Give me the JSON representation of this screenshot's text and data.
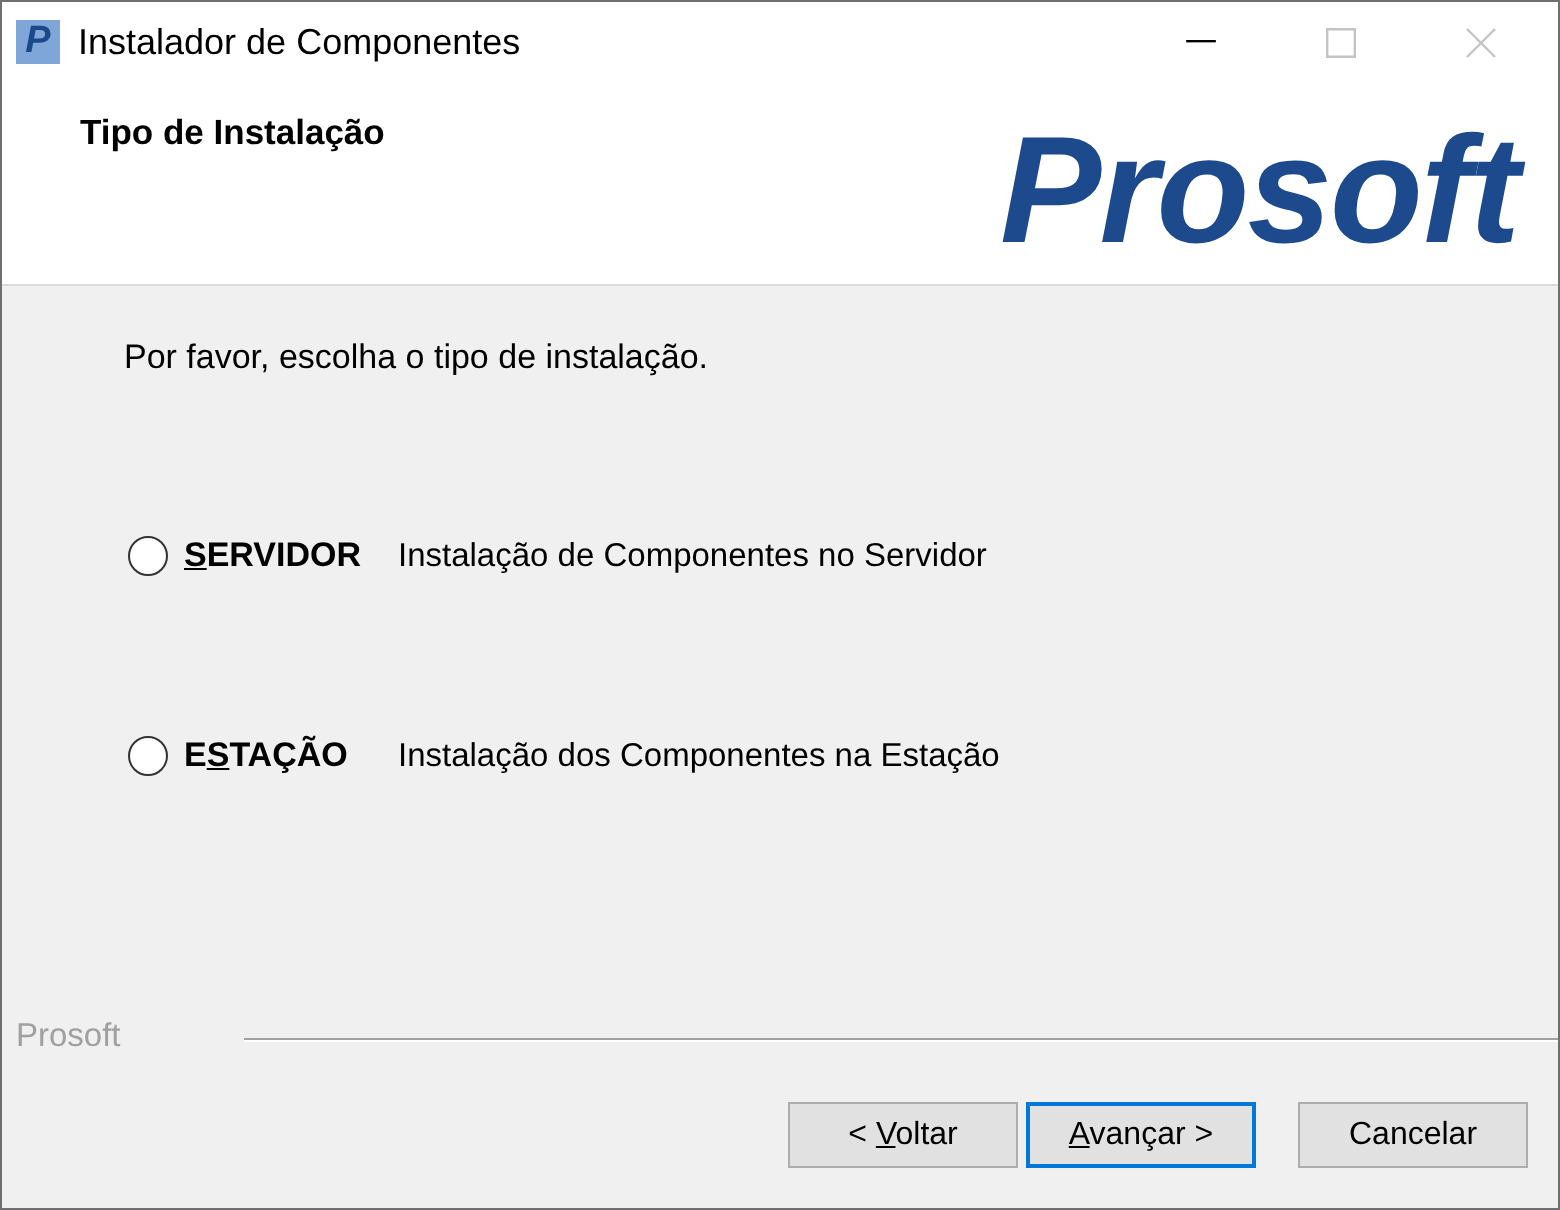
{
  "window": {
    "app_icon": {
      "glyph": "P"
    },
    "title": "Instalador de Componentes",
    "controls": [
      {
        "kind": "minimize",
        "disabled": false
      },
      {
        "kind": "maximize",
        "disabled": true
      },
      {
        "kind": "close",
        "disabled": true
      }
    ]
  },
  "header": {
    "title": "Tipo de Instalação",
    "logo": "Prosoft"
  },
  "instruction": "Por favor, escolha o tipo de instalação.",
  "options": [
    {
      "label": {
        "mnemonic": "S",
        "after": "ERVIDOR"
      },
      "description": "Instalação de Componentes no Servidor",
      "selected": false
    },
    {
      "label": {
        "before": "E",
        "mnemonic": "S",
        "after": "TAÇÃO"
      },
      "description": "Instalação dos Componentes na Estação",
      "selected": false
    }
  ],
  "footer": {
    "brand": "Prosoft"
  },
  "buttons": [
    {
      "label": {
        "before": "< ",
        "mnemonic": "V",
        "after": "oltar"
      },
      "default": false
    },
    {
      "label": {
        "mnemonic": "A",
        "after": "vançar >"
      },
      "default": true
    },
    {
      "label": {
        "before": "Cancelar"
      },
      "default": false
    }
  ]
}
